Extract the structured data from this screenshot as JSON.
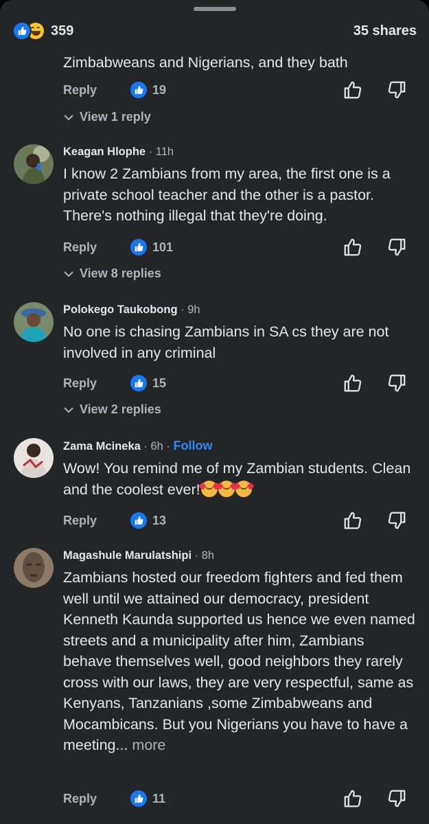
{
  "header": {
    "reaction_count": "359",
    "shares": "35 shares",
    "reaction_icons": [
      "like-icon",
      "haha-icon"
    ]
  },
  "fragment": {
    "text": "Zimbabweans and Nigerians,  and they bath"
  },
  "fragment_actions": {
    "reply": "Reply",
    "likes": "19",
    "view_replies": "View 1 reply"
  },
  "comments": [
    {
      "name": "Keagan Hlophe",
      "time": "· 11h",
      "text": "I know 2 Zambians from my area, the first one is a private school teacher and the other is a pastor. There's nothing illegal that they're doing.",
      "reply": "Reply",
      "likes": "101",
      "view_replies": "View 8 replies"
    },
    {
      "name": "Polokego Taukobong",
      "time": "· 9h",
      "text": "No one is chasing Zambians in SA cs they are not involved in any criminal",
      "reply": "Reply",
      "likes": "15",
      "view_replies": "View 2 replies"
    },
    {
      "name": "Zama Mcineka",
      "time": "· 6h ·",
      "follow": "Follow",
      "text": "Wow! You remind me of my Zambian students. Clean and the coolest ever!",
      "reply": "Reply",
      "likes": "13"
    },
    {
      "name": "Magashule Marulatshipi",
      "time": "· 8h",
      "text": "Zambians hosted our freedom fighters and fed them well until we attained our democracy, president Kenneth Kaunda supported us hence we even named streets and a municipality after him, Zambians behave themselves well, good neighbors they rarely cross with our laws, they are very respectful, same as Kenyans, Tanzanians ,some Zimbabweans and Mocambicans. But you Nigerians you have to have a meeting...",
      "more": "more",
      "reply": "Reply",
      "likes": "11"
    }
  ],
  "colors": {
    "background": "#242527",
    "like_blue": "#1877f2",
    "follow_blue": "#2d88ff",
    "secondary_text": "#b0b3b8"
  }
}
